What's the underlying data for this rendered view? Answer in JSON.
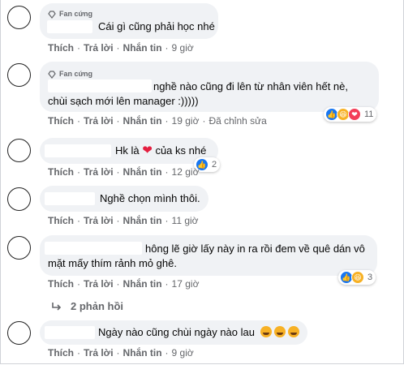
{
  "fan_badge": "Fan cứng",
  "action_labels": {
    "like": "Thích",
    "reply": "Trả lời",
    "message": "Nhắn tin",
    "edited": "Đã chỉnh sửa"
  },
  "comments": [
    {
      "text": "Cái gì cũng phải học nhé",
      "time": "9 giờ"
    },
    {
      "line1": "nghề nào cũng đi lên từ nhân viên hết nè,",
      "line2": "chùi sạch mới lên manager :)))))",
      "time": "19 giờ",
      "reactions": "11"
    },
    {
      "text_before": "Hk là",
      "text_after": "của ks nhé",
      "time": "12 giờ",
      "reactions": "2"
    },
    {
      "text": "Nghề chọn mình thôi.",
      "time": "11 giờ"
    },
    {
      "line1": "hông lẽ giờ lấy này in ra rồi đem về quê dán vô",
      "line2": "mặt mấy thím rảnh mỏ ghê.",
      "time": "17 giờ",
      "reactions": "3"
    },
    {
      "text": "Ngày nào cũng chùi ngày nào lau",
      "time": "9 giờ"
    }
  ],
  "replies_link": "2 phản hồi",
  "colors": {
    "bubble": "#f0f2f5",
    "meta": "#65676b",
    "like": "#1877f2",
    "haha": "#f7b125",
    "love": "#f33e58"
  }
}
